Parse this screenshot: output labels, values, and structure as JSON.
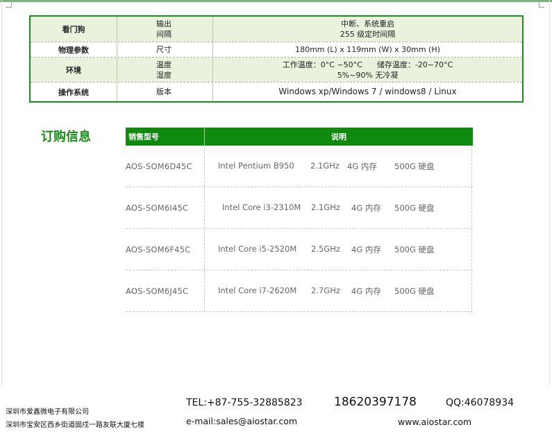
{
  "spec_table": {
    "rows": [
      {
        "category": "看门狗",
        "items": [
          "输出",
          "间隔"
        ],
        "values": [
          "中断、系统重启",
          "255 级定时间隔"
        ]
      },
      {
        "category": "物理参数",
        "items": [
          "尺寸"
        ],
        "values": [
          "180mm (L) x 119mm (W) x 30mm (H)"
        ]
      },
      {
        "category": "环境",
        "items": [
          "温度",
          "湿度"
        ],
        "values": [
          "工作温度：0°C ~50°C      储存温度：-20~70°C",
          "5%~90%  无冷凝"
        ]
      },
      {
        "category": "操作系统",
        "items": [
          "版本"
        ],
        "values": [
          "Windows xp/Windows 7 / windows8 / Linux"
        ]
      }
    ]
  },
  "order": {
    "title": "订购信息",
    "header": {
      "model": "销售型号",
      "desc": "说明"
    },
    "rows": [
      {
        "model": "AOS-SOM6D45C",
        "cpu": "Intel Pentium B950",
        "freq": "2.1GHz",
        "mem": "4G 内存",
        "disk": "500G 硬盘"
      },
      {
        "model": "AOS-SOM6I45C",
        "cpu": "Intel Core i3-2310M",
        "freq": "2.1GHz",
        "mem": "4G 内存",
        "disk": "500G 硬盘"
      },
      {
        "model": "AOS-SOM6F45C",
        "cpu": "Intel Core i5-2520M",
        "freq": "2.5GHz",
        "mem": "4G 内存",
        "disk": "500G 硬盘"
      },
      {
        "model": "AOS-SOM6J45C",
        "cpu": "Intel Core i7-2620M",
        "freq": "2.7GHz",
        "mem": "4G 内存",
        "disk": "500G 硬盘"
      }
    ]
  },
  "footer": {
    "company": "深圳市爱鑫微电子有限公司",
    "address": "深圳市宝安区西乡街道固戍一路友联大厦七楼",
    "tel": "TEL:+87-755-32885823",
    "mobile": "18620397178",
    "qq": "QQ:46078934",
    "email": "e-mail:sales@aiostar.com",
    "website": "www.aiostar.com"
  },
  "colors": {
    "accent": "#0f8a0f",
    "row_tint": "#eaf1dd"
  }
}
